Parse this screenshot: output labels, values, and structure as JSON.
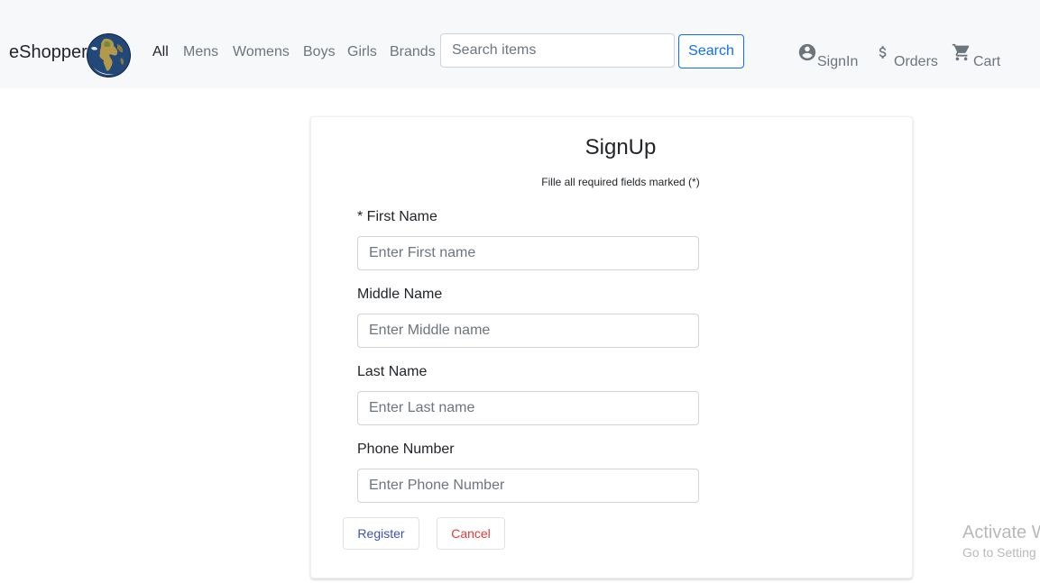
{
  "header": {
    "brand": "eShopper",
    "nav": [
      {
        "label": "All"
      },
      {
        "label": "Mens"
      },
      {
        "label": "Womens"
      },
      {
        "label": "Boys"
      },
      {
        "label": "Girls"
      },
      {
        "label": "Brands"
      }
    ],
    "search": {
      "placeholder": "Search items",
      "value": "",
      "button_label": "Search"
    },
    "actions": {
      "signin": "SignIn",
      "orders": "Orders",
      "cart": "Cart"
    },
    "icons": {
      "logo": "globe-icon",
      "signin": "user-circle-icon",
      "orders": "dollar-icon",
      "cart": "cart-icon"
    }
  },
  "form": {
    "title": "SignUp",
    "subtitle": "Fille all required fields marked (*)",
    "fields": [
      {
        "label": "* First Name",
        "placeholder": "Enter First name"
      },
      {
        "label": "Middle Name",
        "placeholder": "Enter Middle name"
      },
      {
        "label": "Last Name",
        "placeholder": "Enter Last name"
      },
      {
        "label": "Phone Number",
        "placeholder": "Enter Phone Number"
      }
    ],
    "register_label": "Register",
    "cancel_label": "Cancel"
  },
  "watermark": {
    "title": "Activate W",
    "subtitle": "Go to Setting"
  },
  "colors": {
    "navbar_bg": "#f7f8fa",
    "primary": "#0d6efd",
    "register": "#3f51b5",
    "cancel": "#e53935",
    "muted": "#6c757d"
  }
}
